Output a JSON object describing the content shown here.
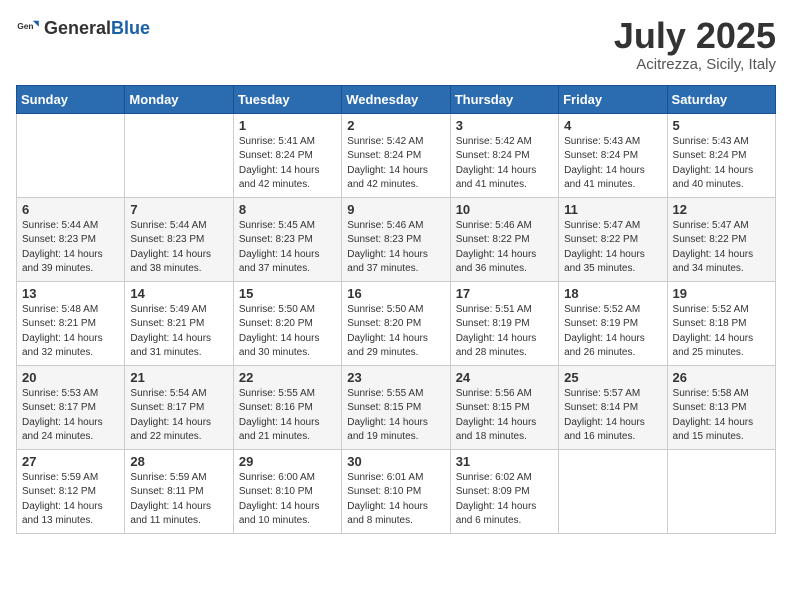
{
  "header": {
    "logo_general": "General",
    "logo_blue": "Blue",
    "month_year": "July 2025",
    "location": "Acitrezza, Sicily, Italy"
  },
  "weekdays": [
    "Sunday",
    "Monday",
    "Tuesday",
    "Wednesday",
    "Thursday",
    "Friday",
    "Saturday"
  ],
  "weeks": [
    [
      {
        "day": null,
        "info": null
      },
      {
        "day": null,
        "info": null
      },
      {
        "day": "1",
        "info": "Sunrise: 5:41 AM\nSunset: 8:24 PM\nDaylight: 14 hours and 42 minutes."
      },
      {
        "day": "2",
        "info": "Sunrise: 5:42 AM\nSunset: 8:24 PM\nDaylight: 14 hours and 42 minutes."
      },
      {
        "day": "3",
        "info": "Sunrise: 5:42 AM\nSunset: 8:24 PM\nDaylight: 14 hours and 41 minutes."
      },
      {
        "day": "4",
        "info": "Sunrise: 5:43 AM\nSunset: 8:24 PM\nDaylight: 14 hours and 41 minutes."
      },
      {
        "day": "5",
        "info": "Sunrise: 5:43 AM\nSunset: 8:24 PM\nDaylight: 14 hours and 40 minutes."
      }
    ],
    [
      {
        "day": "6",
        "info": "Sunrise: 5:44 AM\nSunset: 8:23 PM\nDaylight: 14 hours and 39 minutes."
      },
      {
        "day": "7",
        "info": "Sunrise: 5:44 AM\nSunset: 8:23 PM\nDaylight: 14 hours and 38 minutes."
      },
      {
        "day": "8",
        "info": "Sunrise: 5:45 AM\nSunset: 8:23 PM\nDaylight: 14 hours and 37 minutes."
      },
      {
        "day": "9",
        "info": "Sunrise: 5:46 AM\nSunset: 8:23 PM\nDaylight: 14 hours and 37 minutes."
      },
      {
        "day": "10",
        "info": "Sunrise: 5:46 AM\nSunset: 8:22 PM\nDaylight: 14 hours and 36 minutes."
      },
      {
        "day": "11",
        "info": "Sunrise: 5:47 AM\nSunset: 8:22 PM\nDaylight: 14 hours and 35 minutes."
      },
      {
        "day": "12",
        "info": "Sunrise: 5:47 AM\nSunset: 8:22 PM\nDaylight: 14 hours and 34 minutes."
      }
    ],
    [
      {
        "day": "13",
        "info": "Sunrise: 5:48 AM\nSunset: 8:21 PM\nDaylight: 14 hours and 32 minutes."
      },
      {
        "day": "14",
        "info": "Sunrise: 5:49 AM\nSunset: 8:21 PM\nDaylight: 14 hours and 31 minutes."
      },
      {
        "day": "15",
        "info": "Sunrise: 5:50 AM\nSunset: 8:20 PM\nDaylight: 14 hours and 30 minutes."
      },
      {
        "day": "16",
        "info": "Sunrise: 5:50 AM\nSunset: 8:20 PM\nDaylight: 14 hours and 29 minutes."
      },
      {
        "day": "17",
        "info": "Sunrise: 5:51 AM\nSunset: 8:19 PM\nDaylight: 14 hours and 28 minutes."
      },
      {
        "day": "18",
        "info": "Sunrise: 5:52 AM\nSunset: 8:19 PM\nDaylight: 14 hours and 26 minutes."
      },
      {
        "day": "19",
        "info": "Sunrise: 5:52 AM\nSunset: 8:18 PM\nDaylight: 14 hours and 25 minutes."
      }
    ],
    [
      {
        "day": "20",
        "info": "Sunrise: 5:53 AM\nSunset: 8:17 PM\nDaylight: 14 hours and 24 minutes."
      },
      {
        "day": "21",
        "info": "Sunrise: 5:54 AM\nSunset: 8:17 PM\nDaylight: 14 hours and 22 minutes."
      },
      {
        "day": "22",
        "info": "Sunrise: 5:55 AM\nSunset: 8:16 PM\nDaylight: 14 hours and 21 minutes."
      },
      {
        "day": "23",
        "info": "Sunrise: 5:55 AM\nSunset: 8:15 PM\nDaylight: 14 hours and 19 minutes."
      },
      {
        "day": "24",
        "info": "Sunrise: 5:56 AM\nSunset: 8:15 PM\nDaylight: 14 hours and 18 minutes."
      },
      {
        "day": "25",
        "info": "Sunrise: 5:57 AM\nSunset: 8:14 PM\nDaylight: 14 hours and 16 minutes."
      },
      {
        "day": "26",
        "info": "Sunrise: 5:58 AM\nSunset: 8:13 PM\nDaylight: 14 hours and 15 minutes."
      }
    ],
    [
      {
        "day": "27",
        "info": "Sunrise: 5:59 AM\nSunset: 8:12 PM\nDaylight: 14 hours and 13 minutes."
      },
      {
        "day": "28",
        "info": "Sunrise: 5:59 AM\nSunset: 8:11 PM\nDaylight: 14 hours and 11 minutes."
      },
      {
        "day": "29",
        "info": "Sunrise: 6:00 AM\nSunset: 8:10 PM\nDaylight: 14 hours and 10 minutes."
      },
      {
        "day": "30",
        "info": "Sunrise: 6:01 AM\nSunset: 8:10 PM\nDaylight: 14 hours and 8 minutes."
      },
      {
        "day": "31",
        "info": "Sunrise: 6:02 AM\nSunset: 8:09 PM\nDaylight: 14 hours and 6 minutes."
      },
      {
        "day": null,
        "info": null
      },
      {
        "day": null,
        "info": null
      }
    ]
  ]
}
